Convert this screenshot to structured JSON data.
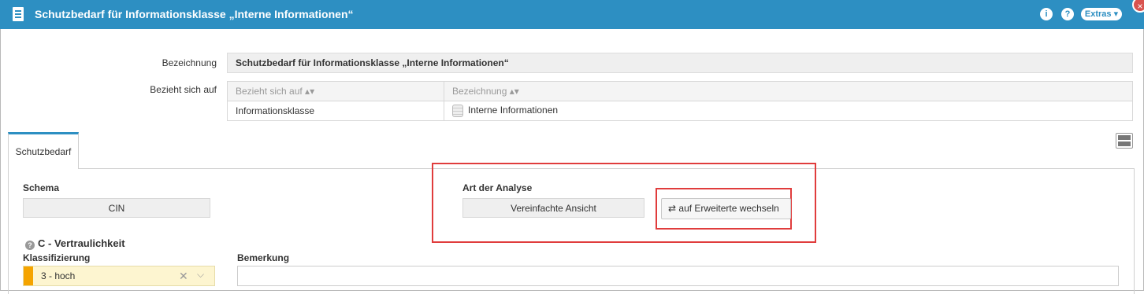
{
  "window": {
    "title": "Schutzbedarf für Informationsklasse „Interne Informationen“",
    "info_icon": "info-icon",
    "help_icon": "help-icon",
    "extras_label": "Extras ▾",
    "close_label": "×"
  },
  "header_fields": {
    "bezeichnung_label": "Bezeichnung",
    "bezeichnung_value": "Schutzbedarf für Informationsklasse „Interne Informationen“",
    "bezieht_label": "Bezieht sich auf"
  },
  "reference_table": {
    "columns": [
      "Bezieht sich auf ▴▾",
      "Bezeichnung ▴▾"
    ],
    "rows": [
      [
        "Informationsklasse",
        "Interne Informationen"
      ]
    ]
  },
  "tabs": [
    {
      "label": "Schutzbedarf"
    }
  ],
  "form": {
    "schema_label": "Schema",
    "schema_value": "CIN",
    "analysis_label": "Art der Analyse",
    "analysis_value": "Vereinfachte Ansicht",
    "switch_button_label": "auf Erweiterte wechseln",
    "section_title": "C - Vertraulichkeit",
    "klassifizierung_label": "Klassifizierung",
    "klassifizierung_value": "3 - hoch",
    "bemerkung_label": "Bemerkung",
    "bemerkung_value": ""
  },
  "colors": {
    "titlebar": "#2d8fc2",
    "highlight_box": "#e03c3c",
    "classification_stripe": "#f5a400",
    "classification_bg": "#fdf5d0"
  }
}
